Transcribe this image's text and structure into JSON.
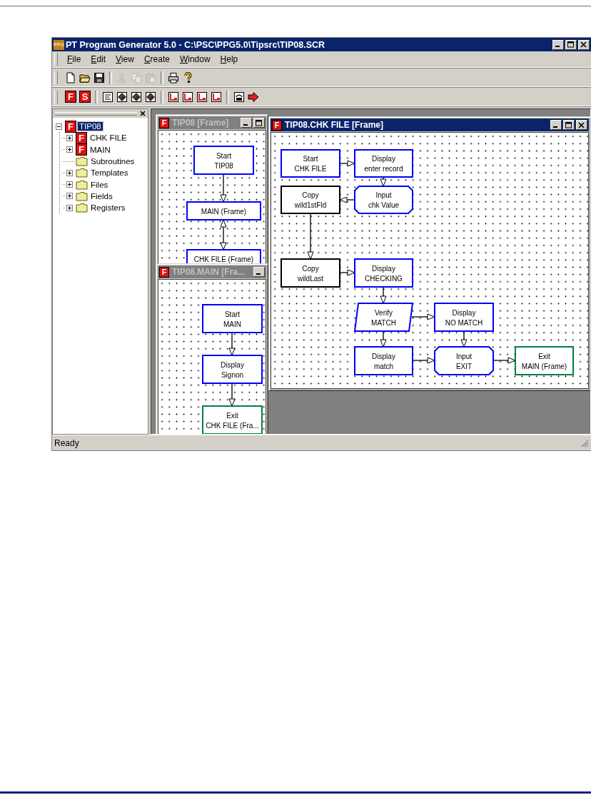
{
  "app": {
    "icon_text": "PPG",
    "title": "PT Program Generator 5.0 - C:\\PSC\\PPG5.0\\Tipsrc\\TIP08.SCR"
  },
  "menu": [
    {
      "label": "File"
    },
    {
      "label": "Edit"
    },
    {
      "label": "View"
    },
    {
      "label": "Create"
    },
    {
      "label": "Window"
    },
    {
      "label": "Help"
    }
  ],
  "toolbars": [
    [
      [
        {
          "kind": "new",
          "disabled": false
        },
        {
          "kind": "open",
          "disabled": false
        },
        {
          "kind": "save",
          "disabled": false
        }
      ],
      [
        {
          "kind": "cut",
          "disabled": true
        },
        {
          "kind": "copy",
          "disabled": true
        },
        {
          "kind": "paste",
          "disabled": true
        }
      ],
      [
        {
          "kind": "print",
          "disabled": false
        },
        {
          "kind": "help",
          "disabled": false
        }
      ]
    ],
    [
      [
        {
          "kind": "letter",
          "label": "F",
          "disabled": false
        },
        {
          "kind": "letter",
          "label": "S",
          "disabled": false
        }
      ],
      [
        {
          "kind": "form",
          "disabled": false
        },
        {
          "kind": "diamond",
          "disabled": false
        },
        {
          "kind": "diamond",
          "disabled": false
        },
        {
          "kind": "diamond",
          "disabled": false
        }
      ],
      [
        {
          "kind": "connector",
          "disabled": false
        },
        {
          "kind": "connector",
          "disabled": false
        },
        {
          "kind": "connector",
          "disabled": false
        },
        {
          "kind": "connector",
          "disabled": false
        }
      ],
      [
        {
          "kind": "phone",
          "disabled": false
        },
        {
          "kind": "arrow",
          "disabled": false
        }
      ]
    ]
  ],
  "tree": [
    {
      "label": "TIP08",
      "kind": "frame",
      "icon_text": "F",
      "expanded": true,
      "selected": true,
      "children": [
        {
          "label": "CHK FILE",
          "kind": "frame",
          "icon_text": "F",
          "expanded": false,
          "selected": false
        },
        {
          "label": "MAIN",
          "kind": "frame",
          "icon_text": "F",
          "expanded": false,
          "selected": false
        },
        {
          "label": "Subroutines",
          "kind": "folder",
          "selected": false
        },
        {
          "label": "Templates",
          "kind": "folder",
          "expanded": false,
          "selected": false
        },
        {
          "label": "Files",
          "kind": "folder",
          "expanded": false,
          "selected": false
        },
        {
          "label": "Fields",
          "kind": "folder",
          "expanded": false,
          "selected": false
        },
        {
          "label": "Registers",
          "kind": "folder",
          "expanded": false,
          "selected": false
        }
      ]
    }
  ],
  "windows": [
    {
      "title": "TIP08 [Frame]",
      "icon_text": "F",
      "active": false,
      "nodes": [
        {
          "kind": "box",
          "color": "#0000ff",
          "lines": [
            "Start",
            "TIP08"
          ]
        },
        {
          "kind": "box",
          "color": "#0000ff",
          "lines": [
            "MAIN (Frame)"
          ]
        },
        {
          "kind": "box",
          "color": "#0000ff",
          "lines": [
            "CHK FILE (Frame)"
          ]
        }
      ]
    },
    {
      "title": "TIP08.MAIN [Fra...",
      "icon_text": "F",
      "active": false,
      "nodes": [
        {
          "kind": "box",
          "color": "#0000ff",
          "lines": [
            "Start",
            "MAIN"
          ]
        },
        {
          "kind": "box",
          "color": "#0000ff",
          "lines": [
            "Display",
            "Signon"
          ]
        },
        {
          "kind": "box",
          "color": "#008040",
          "lines": [
            "Exit",
            "CHK FILE (Fra..."
          ]
        }
      ]
    },
    {
      "title": "TIP08.CHK FILE [Frame]",
      "icon_text": "F",
      "active": true,
      "nodes": [
        {
          "kind": "box",
          "color": "#0000ff",
          "lines": [
            "Start",
            "CHK FILE"
          ]
        },
        {
          "kind": "box",
          "color": "#0000ff",
          "lines": [
            "Display",
            "enter record"
          ]
        },
        {
          "kind": "box",
          "color": "#000000",
          "lines": [
            "Copy",
            "wild1stFld"
          ]
        },
        {
          "kind": "octagon",
          "color": "#0000ff",
          "lines": [
            "Input",
            "chk Value"
          ]
        },
        {
          "kind": "box",
          "color": "#000000",
          "lines": [
            "Copy",
            "wildLast"
          ]
        },
        {
          "kind": "box",
          "color": "#0000ff",
          "lines": [
            "Display",
            "CHECKING"
          ]
        },
        {
          "kind": "parallelogram",
          "color": "#0000ff",
          "lines": [
            "Verify",
            "MATCH"
          ]
        },
        {
          "kind": "box",
          "color": "#0000ff",
          "lines": [
            "Display",
            "NO MATCH"
          ]
        },
        {
          "kind": "box",
          "color": "#0000ff",
          "lines": [
            "Display",
            "match"
          ]
        },
        {
          "kind": "octagon",
          "color": "#0000ff",
          "lines": [
            "Input",
            "EXIT"
          ]
        },
        {
          "kind": "box",
          "color": "#008040",
          "lines": [
            "Exit",
            "MAIN (Frame)"
          ]
        }
      ]
    }
  ],
  "status_bar": {
    "text": "Ready"
  }
}
